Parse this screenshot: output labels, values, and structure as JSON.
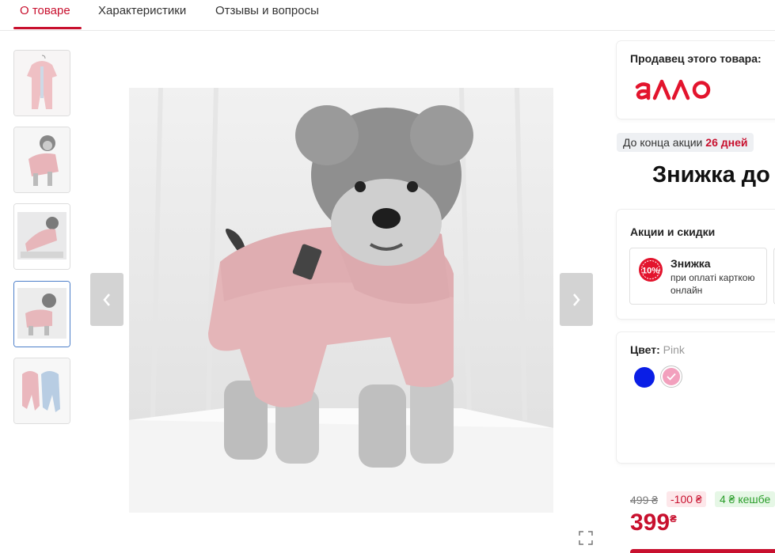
{
  "tabs": [
    {
      "label": "О товаре",
      "active": true
    },
    {
      "label": "Характеристики",
      "active": false
    },
    {
      "label": "Отзывы и вопросы",
      "active": false
    }
  ],
  "gallery": {
    "thumbnails": [
      "jumpsuit-hanger",
      "dog-sitting-pink",
      "dog-lying-pink",
      "dog-standing-pink",
      "two-jumpsuits-pink-blue"
    ],
    "active_index": 3,
    "prev_icon": "chevron-left-icon",
    "next_icon": "chevron-right-icon",
    "expand_icon": "expand-icon"
  },
  "seller": {
    "title": "Продавец этого товара:",
    "logo_text": "аллo",
    "logo_color": "#e3142d"
  },
  "promo": {
    "timer_prefix": "До конца акции",
    "timer_value": "26 дней",
    "headline": "Знижка до"
  },
  "discounts": {
    "title": "Акции и скидки",
    "badge": "10%",
    "item_title": "Знижка",
    "item_sub": "при оплаті карткою онлайн"
  },
  "color": {
    "label": "Цвет:",
    "value": "Pink",
    "options": [
      {
        "name": "Blue",
        "hex": "#0a1ee6",
        "selected": false
      },
      {
        "name": "Pink",
        "hex": "#f2a0bd",
        "selected": true
      }
    ]
  },
  "price": {
    "old": "499 ₴",
    "discount": "-100 ₴",
    "cashback": "4 ₴ кешбе",
    "current": "399",
    "currency": "₴",
    "accent": "#c8102e"
  }
}
